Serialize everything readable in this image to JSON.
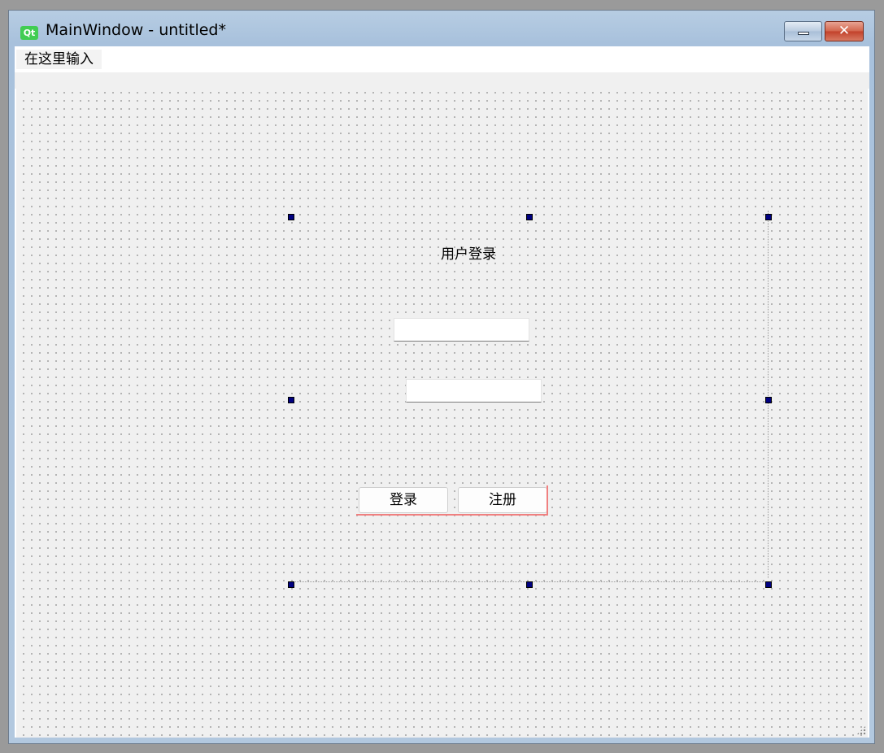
{
  "window": {
    "title": "MainWindow - untitled*",
    "logo_text": "Qt",
    "minimize_icon": "minimize-icon",
    "close_icon": "close-icon",
    "close_glyph": "✕"
  },
  "menubar": {
    "items": [
      {
        "label": "在这里输入"
      }
    ]
  },
  "form": {
    "title_label": "用户登录",
    "username_value": "",
    "password_value": "",
    "login_button": "登录",
    "register_button": "注册"
  },
  "colors": {
    "selection_handle": "#000080",
    "layout_marker": "#f08080",
    "qt_brand": "#41cd52"
  }
}
